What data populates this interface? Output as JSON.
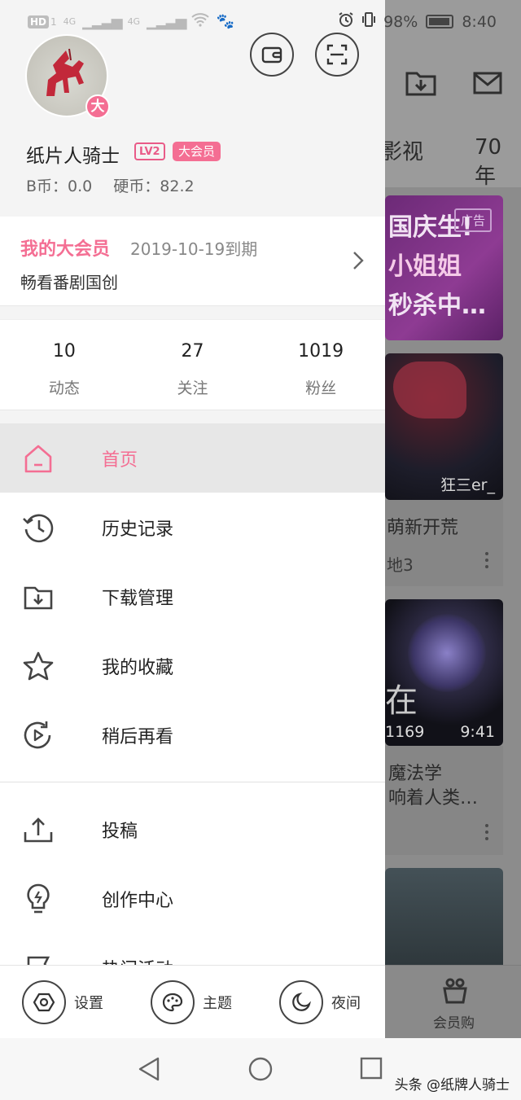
{
  "status_bar": {
    "hd_label": "HD",
    "sim1": "1",
    "net1": "4G",
    "net2": "4G",
    "battery": "98%",
    "time": "8:40"
  },
  "background": {
    "tabs": [
      "影视",
      "70年"
    ],
    "card1": {
      "ad_label": "广告",
      "line1": "国庆生!",
      "line2": "小姐姐",
      "line3": "秒杀中…"
    },
    "card2": {
      "overlay": "狂三er_",
      "title": "萌新开荒",
      "sub": "地3"
    },
    "card3": {
      "big_text": "在",
      "count": "1169",
      "duration": "9:41",
      "title1": "魔法学",
      "title2": "响着人类…"
    },
    "shop_label": "会员购"
  },
  "profile": {
    "username": "纸片人骑士",
    "level": "LV2",
    "vip_badge": "大会员",
    "vip_avatar_mark": "大",
    "b_coin": "B币：0.0",
    "hard_coin": "硬币：82.2"
  },
  "vip": {
    "title": "我的大会员",
    "expiry": "2019-10-19到期",
    "desc": "畅看番剧国创"
  },
  "stats": [
    {
      "value": "10",
      "label": "动态"
    },
    {
      "value": "27",
      "label": "关注"
    },
    {
      "value": "1019",
      "label": "粉丝"
    }
  ],
  "menu": [
    {
      "label": "首页",
      "icon": "home-icon"
    },
    {
      "label": "历史记录",
      "icon": "history-icon"
    },
    {
      "label": "下载管理",
      "icon": "download-icon"
    },
    {
      "label": "我的收藏",
      "icon": "star-icon"
    },
    {
      "label": "稍后再看",
      "icon": "watch-later-icon"
    },
    {
      "label": "投稿",
      "icon": "upload-icon"
    },
    {
      "label": "创作中心",
      "icon": "lightbulb-icon"
    },
    {
      "label": "热门活动",
      "icon": "flag-icon"
    }
  ],
  "bottom_bar": {
    "settings": "设置",
    "theme": "主题",
    "night": "夜间"
  },
  "watermark": "头条 @纸牌人骑士",
  "colors": {
    "accent": "#f46e93",
    "active_bg": "#e7e7e7"
  }
}
